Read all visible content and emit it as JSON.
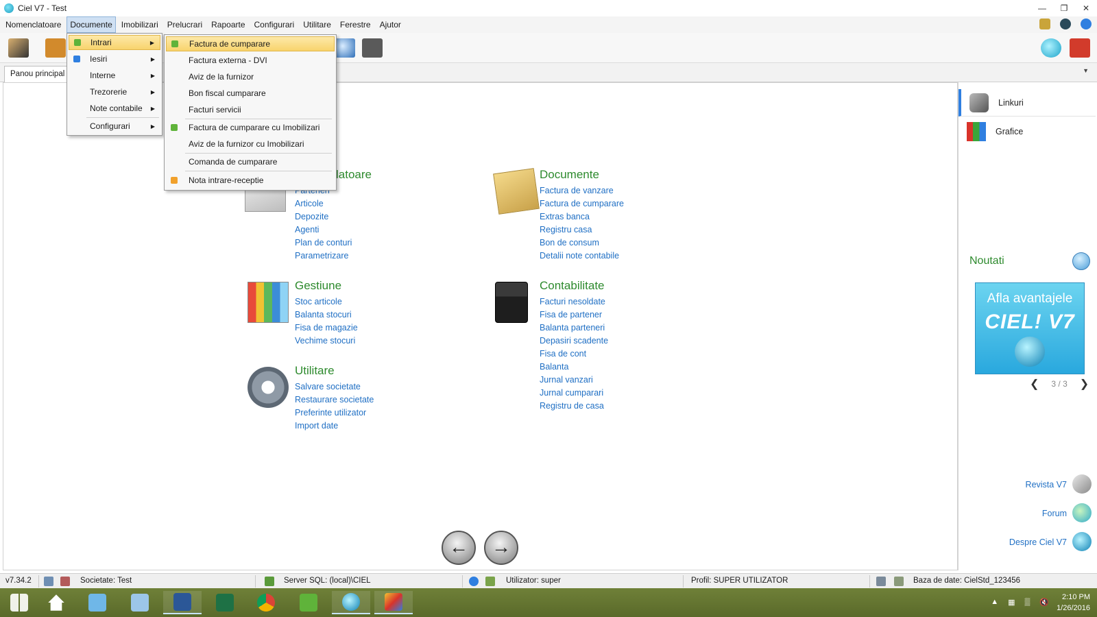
{
  "window": {
    "title": "Ciel V7 - Test"
  },
  "menubar": {
    "items": [
      "Nomenclatoare",
      "Documente",
      "Imobilizari",
      "Prelucrari",
      "Rapoarte",
      "Configurari",
      "Utilitare",
      "Ferestre",
      "Ajutor"
    ],
    "active": "Documente"
  },
  "tabs": {
    "active": "Panou principal"
  },
  "documente_menu": {
    "items": [
      "Intrari",
      "Iesiri",
      "Interne",
      "Trezorerie",
      "Note contabile",
      "Configurari"
    ]
  },
  "intrari_submenu": {
    "items": [
      "Factura de cumparare",
      "Factura externa - DVI",
      "Aviz de la furnizor",
      "Bon fiscal cumparare",
      "Facturi servicii",
      "Factura de cumparare cu Imobilizari",
      "Aviz de la furnizor cu Imobilizari",
      "Comanda de cumparare",
      "Nota intrare-receptie"
    ]
  },
  "sections": {
    "nomenclatoare": {
      "heading_visible_part": "latoare",
      "links": [
        "Parteneri",
        "Articole",
        "Depozite",
        "Agenti",
        "Plan de conturi",
        "Parametrizare"
      ]
    },
    "documente": {
      "heading": "Documente",
      "links": [
        "Factura de vanzare",
        "Factura de cumparare",
        "Extras banca",
        "Registru casa",
        "Bon de consum",
        "Detalii note contabile"
      ]
    },
    "gestiune": {
      "heading": "Gestiune",
      "links": [
        "Stoc articole",
        "Balanta stocuri",
        "Fisa de magazie",
        "Vechime stocuri"
      ]
    },
    "contabilitate": {
      "heading": "Contabilitate",
      "links": [
        "Facturi nesoldate",
        "Fisa de partener",
        "Balanta parteneri",
        "Depasiri scadente",
        "Fisa de cont",
        "Balanta",
        "Jurnal vanzari",
        "Jurnal cumparari",
        "Registru de casa"
      ]
    },
    "utilitare": {
      "heading": "Utilitare",
      "links": [
        "Salvare societate",
        "Restaurare societate",
        "Preferinte utilizator",
        "Import date"
      ]
    }
  },
  "right_panel": {
    "links_label": "Linkuri",
    "charts_label": "Grafice",
    "news_title": "Noutati",
    "promo_text": "Afla avantajele",
    "promo_logo": "CIEL! V7",
    "pager": "3 / 3",
    "bottom_links": [
      "Revista V7",
      "Forum",
      "Despre Ciel V7"
    ]
  },
  "statusbar": {
    "version": "v7.34.2",
    "company": "Societate: Test",
    "server": "Server SQL: (local)\\CIEL",
    "user": "Utilizator: super",
    "profile": "Profil: SUPER UTILIZATOR",
    "database": "Baza de date: CielStd_123456"
  },
  "taskbar": {
    "time": "2:10 PM",
    "date": "1/26/2016"
  }
}
